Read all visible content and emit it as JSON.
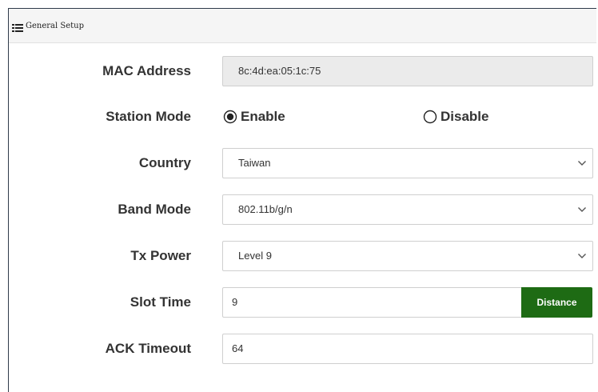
{
  "panel": {
    "title": "General Setup",
    "header_icon": "list-icon"
  },
  "fields": {
    "mac_address": {
      "label": "MAC Address",
      "value": "8c:4d:ea:05:1c:75"
    },
    "station_mode": {
      "label": "Station Mode",
      "options": [
        {
          "label": "Enable",
          "selected": true
        },
        {
          "label": "Disable",
          "selected": false
        }
      ]
    },
    "country": {
      "label": "Country",
      "value": "Taiwan",
      "icon": "chevron-down-icon"
    },
    "band_mode": {
      "label": "Band Mode",
      "value": "802.11b/g/n",
      "icon": "chevron-down-icon"
    },
    "tx_power": {
      "label": "Tx Power",
      "value": "Level 9",
      "icon": "chevron-down-icon"
    },
    "slot_time": {
      "label": "Slot Time",
      "value": "9",
      "button": "Distance",
      "button_color": "#1e6b14"
    },
    "ack_timeout": {
      "label": "ACK Timeout",
      "value": "64"
    }
  }
}
